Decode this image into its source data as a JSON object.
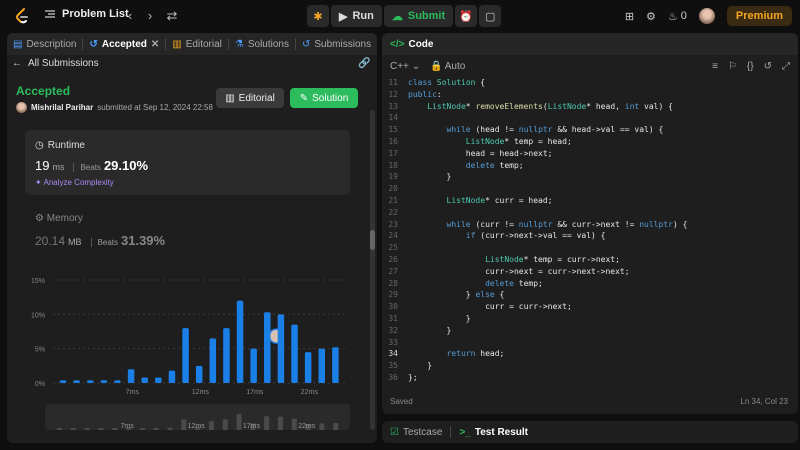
{
  "topbar": {
    "problem_list": "Problem List",
    "run": "Run",
    "submit": "Submit",
    "streak": "0",
    "premium": "Premium"
  },
  "left_tabs": [
    {
      "label": "Description"
    },
    {
      "label": "Accepted"
    },
    {
      "label": "Editorial"
    },
    {
      "label": "Solutions"
    },
    {
      "label": "Submissions"
    }
  ],
  "submission": {
    "back_label": "All Submissions",
    "status": "Accepted",
    "author": "Mishrilal Parihar",
    "submitted_text": "submitted at Sep 12, 2024 22:58",
    "editorial_btn": "Editorial",
    "solution_btn": "Solution"
  },
  "runtime": {
    "title": "Runtime",
    "value": "19",
    "unit": "ms",
    "beats_label": "Beats",
    "beats": "29.10%",
    "analyze": "Analyze Complexity"
  },
  "memory": {
    "title": "Memory",
    "value": "20.14",
    "unit": "MB",
    "beats_label": "Beats",
    "beats": "31.39%"
  },
  "chart_data": {
    "type": "bar",
    "y_ticks": [
      "15%",
      "10%",
      "5%",
      "0%"
    ],
    "x_ticks": [
      "7ms",
      "12ms",
      "17ms",
      "22ms"
    ],
    "ylim": [
      0,
      15
    ],
    "values": [
      0.4,
      0.4,
      0.4,
      0.4,
      0.4,
      2,
      0.8,
      0.8,
      1.8,
      8,
      2.5,
      6.5,
      8,
      12,
      5,
      10.3,
      10,
      8.5,
      4.5,
      5,
      5.2
    ],
    "highlight_index": 12,
    "colors": {
      "bar": "#1a7fe6"
    }
  },
  "editor": {
    "header": "Code",
    "language": "C++",
    "auto": "Auto",
    "status_left": "Saved",
    "status_right": "Ln 34, Col 23",
    "lines": [
      {
        "n": "11",
        "t": "class Solution {"
      },
      {
        "n": "12",
        "t": "public:"
      },
      {
        "n": "13",
        "t": "    ListNode* removeElements(ListNode* head, int val) {"
      },
      {
        "n": "14",
        "t": ""
      },
      {
        "n": "15",
        "t": "        while (head != nullptr && head->val == val) {"
      },
      {
        "n": "16",
        "t": "            ListNode* temp = head;"
      },
      {
        "n": "17",
        "t": "            head = head->next;"
      },
      {
        "n": "18",
        "t": "            delete temp;"
      },
      {
        "n": "19",
        "t": "        }"
      },
      {
        "n": "20",
        "t": ""
      },
      {
        "n": "21",
        "t": "        ListNode* curr = head;"
      },
      {
        "n": "22",
        "t": ""
      },
      {
        "n": "23",
        "t": "        while (curr != nullptr && curr->next != nullptr) {"
      },
      {
        "n": "24",
        "t": "            if (curr->next->val == val) {"
      },
      {
        "n": "25",
        "t": ""
      },
      {
        "n": "26",
        "t": "                ListNode* temp = curr->next;"
      },
      {
        "n": "27",
        "t": "                curr->next = curr->next->next;"
      },
      {
        "n": "28",
        "t": "                delete temp;"
      },
      {
        "n": "29",
        "t": "            } else {"
      },
      {
        "n": "30",
        "t": "                curr = curr->next;"
      },
      {
        "n": "31",
        "t": "            }"
      },
      {
        "n": "32",
        "t": "        }"
      },
      {
        "n": "33",
        "t": ""
      },
      {
        "n": "34",
        "t": "        return head;"
      },
      {
        "n": "35",
        "t": "    }"
      },
      {
        "n": "36",
        "t": "};"
      }
    ]
  },
  "bottom": {
    "testcase": "Testcase",
    "test_result": "Test Result"
  }
}
